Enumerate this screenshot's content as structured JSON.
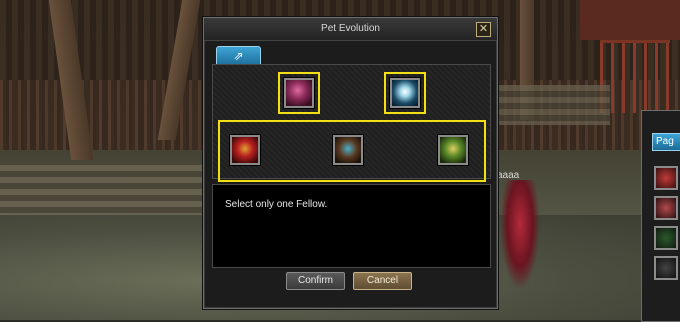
{
  "dialog": {
    "title": "Pet Evolution",
    "close_symbol": "✕",
    "tab_icon": "evolve-arrow-icon",
    "tab_glyph": "⇗",
    "target_pets": [
      {
        "icon": "pink-creature-pet-icon"
      },
      {
        "icon": "penguin-pet-icon"
      }
    ],
    "fellow_options": [
      {
        "icon": "red-fellow-pet-icon"
      },
      {
        "icon": "dark-fellow-pet-icon"
      },
      {
        "icon": "green-fellow-pet-icon"
      }
    ],
    "message": "Select only one Fellow.",
    "confirm_label": "Confirm",
    "cancel_label": "Cancel",
    "highlight_color": "#f2e014"
  },
  "background": {
    "character_name": "aaaa"
  },
  "side_window": {
    "tab_label": "Pag"
  }
}
